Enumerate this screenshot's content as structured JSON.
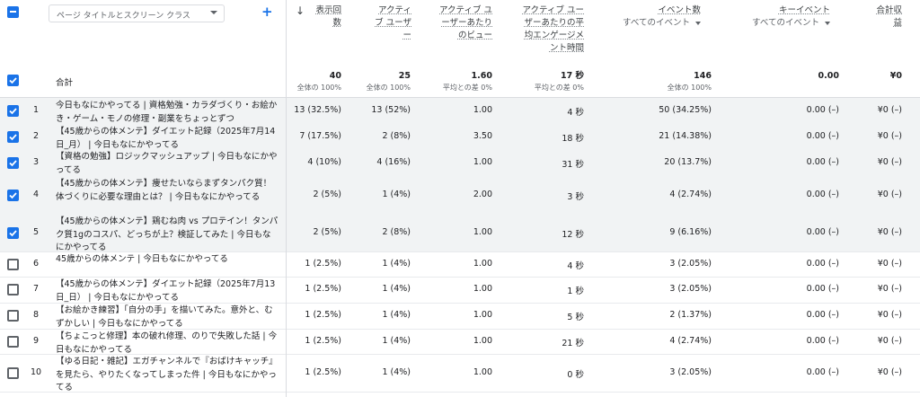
{
  "header": {
    "dimension_label": "ページ タイトルとスクリーン クラス",
    "sort_icon": "arrow-down-icon",
    "columns": [
      {
        "key": "views",
        "lines": [
          "表示回",
          "数"
        ]
      },
      {
        "key": "active_users",
        "lines": [
          "アクティ",
          "ブ ユーザ",
          "ー"
        ]
      },
      {
        "key": "views_per_user",
        "lines": [
          "アクティブ ユ",
          "ーザーあたり",
          "のビュー"
        ]
      },
      {
        "key": "engagement",
        "lines": [
          "アクティブ ユー",
          "ザーあたりの平",
          "均エンゲージメ",
          "ント時間"
        ]
      },
      {
        "key": "events",
        "lines": [
          "イベント数"
        ],
        "sub": "すべてのイベント"
      },
      {
        "key": "key_events",
        "lines": [
          "キーイベント"
        ],
        "sub": "すべてのイベント"
      },
      {
        "key": "revenue",
        "lines": [
          "合計収",
          "益"
        ]
      }
    ]
  },
  "totals": {
    "label": "合計",
    "views": {
      "value": "40",
      "sub": "全体の 100%"
    },
    "active_users": {
      "value": "25",
      "sub": "全体の 100%"
    },
    "views_per_user": {
      "value": "1.60",
      "sub": "平均との差 0%"
    },
    "engagement": {
      "value": "17 秒",
      "sub": "平均との差 0%"
    },
    "events": {
      "value": "146",
      "sub": "全体の 100%"
    },
    "key_events": {
      "value": "0.00"
    },
    "revenue": {
      "value": "¥0"
    }
  },
  "rows": [
    {
      "num": "1",
      "checked": true,
      "title": "今日もなにかやってる | 資格勉強・カラダづくり・お絵かき・ゲーム・モノの修理・副業をちょっとずつ",
      "views": "13 (32.5%)",
      "users": "13 (52%)",
      "vpu": "1.00",
      "eng": "4 秒",
      "events": "50 (34.25%)",
      "key": "0.00 (–)",
      "rev": "¥0 (–)"
    },
    {
      "num": "2",
      "checked": true,
      "title": "【45歳からの体メンテ】ダイエット記録（2025年7月14日_月） | 今日もなにかやってる",
      "views": "7 (17.5%)",
      "users": "2 (8%)",
      "vpu": "3.50",
      "eng": "18 秒",
      "events": "21 (14.38%)",
      "key": "0.00 (–)",
      "rev": "¥0 (–)"
    },
    {
      "num": "3",
      "checked": true,
      "title": "【資格の勉強】ロジックマッシュアップ | 今日もなにかやってる",
      "views": "4 (10%)",
      "users": "4 (16%)",
      "vpu": "1.00",
      "eng": "31 秒",
      "events": "20 (13.7%)",
      "key": "0.00 (–)",
      "rev": "¥0 (–)"
    },
    {
      "num": "4",
      "checked": true,
      "title": "【45歳からの体メンテ】痩せたいならまずタンパク質！ 体づくりに必要な理由とは？ | 今日もなにかやってる",
      "views": "2 (5%)",
      "users": "1 (4%)",
      "vpu": "2.00",
      "eng": "3 秒",
      "events": "4 (2.74%)",
      "key": "0.00 (–)",
      "rev": "¥0 (–)"
    },
    {
      "num": "5",
      "checked": true,
      "title": "【45歳からの体メンテ】鶏むね肉 vs プロテイン！タンパク質1gのコスパ、どっちが上？検証してみた | 今日もなにかやってる",
      "views": "2 (5%)",
      "users": "2 (8%)",
      "vpu": "1.00",
      "eng": "12 秒",
      "events": "9 (6.16%)",
      "key": "0.00 (–)",
      "rev": "¥0 (–)"
    },
    {
      "num": "6",
      "checked": false,
      "title": "45歳からの体メンテ | 今日もなにかやってる",
      "views": "1 (2.5%)",
      "users": "1 (4%)",
      "vpu": "1.00",
      "eng": "4 秒",
      "events": "3 (2.05%)",
      "key": "0.00 (–)",
      "rev": "¥0 (–)"
    },
    {
      "num": "7",
      "checked": false,
      "title": "【45歳からの体メンテ】ダイエット記録（2025年7月13日_日） | 今日もなにかやってる",
      "views": "1 (2.5%)",
      "users": "1 (4%)",
      "vpu": "1.00",
      "eng": "1 秒",
      "events": "3 (2.05%)",
      "key": "0.00 (–)",
      "rev": "¥0 (–)"
    },
    {
      "num": "8",
      "checked": false,
      "title": "【お絵かき練習】「自分の手」を描いてみた。意外と、むずかしい | 今日もなにかやってる",
      "views": "1 (2.5%)",
      "users": "1 (4%)",
      "vpu": "1.00",
      "eng": "5 秒",
      "events": "2 (1.37%)",
      "key": "0.00 (–)",
      "rev": "¥0 (–)"
    },
    {
      "num": "9",
      "checked": false,
      "title": "【ちょこっと修理】本の破れ修理、のりで失敗した話 | 今日もなにかやってる",
      "views": "1 (2.5%)",
      "users": "1 (4%)",
      "vpu": "1.00",
      "eng": "21 秒",
      "events": "4 (2.74%)",
      "key": "0.00 (–)",
      "rev": "¥0 (–)"
    },
    {
      "num": "10",
      "checked": false,
      "title": "【ゆる日記・雑記】エガチャンネルで『おばけキャッチ』を見たら、やりたくなってしまった件 | 今日もなにかやってる",
      "views": "1 (2.5%)",
      "users": "1 (4%)",
      "vpu": "1.00",
      "eng": "0 秒",
      "events": "3 (2.05%)",
      "key": "0.00 (–)",
      "rev": "¥0 (–)"
    }
  ]
}
